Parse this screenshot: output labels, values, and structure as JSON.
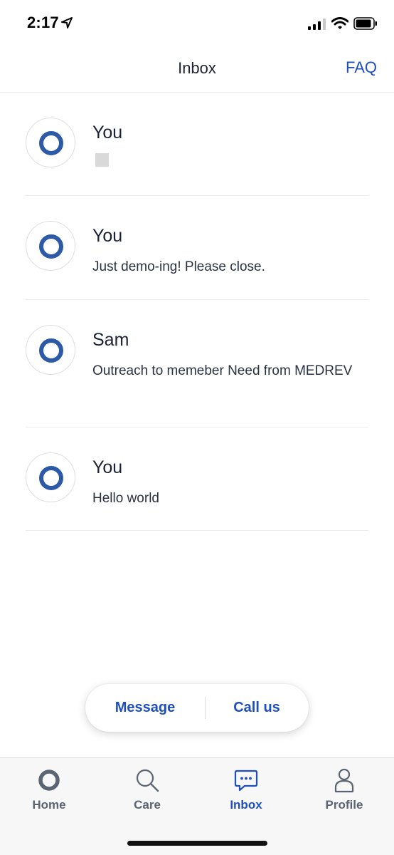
{
  "status_bar": {
    "time": "2:17",
    "icons": [
      "location-arrow-icon",
      "cellular-signal-icon",
      "wifi-icon",
      "battery-icon"
    ]
  },
  "header": {
    "title": "Inbox",
    "faq_label": "FAQ"
  },
  "messages": [
    {
      "sender": "You",
      "snippet": "",
      "has_placeholder_attachment": true
    },
    {
      "sender": "You",
      "snippet": "Just demo-ing! Please close."
    },
    {
      "sender": "Sam",
      "snippet": "Outreach to memeber Need from MEDREV"
    },
    {
      "sender": "You",
      "snippet": "Hello world"
    }
  ],
  "actions": {
    "message_label": "Message",
    "call_label": "Call us"
  },
  "tabs": [
    {
      "label": "Home",
      "icon": "home-ring-icon",
      "active": false
    },
    {
      "label": "Care",
      "icon": "search-icon",
      "active": false
    },
    {
      "label": "Inbox",
      "icon": "chat-bubble-icon",
      "active": true
    },
    {
      "label": "Profile",
      "icon": "person-icon",
      "active": false
    }
  ],
  "colors": {
    "accent": "#1f4fbf",
    "avatar_ring": "#2d5aa6",
    "text_primary": "#1b2236",
    "tab_inactive": "#5b6472"
  }
}
